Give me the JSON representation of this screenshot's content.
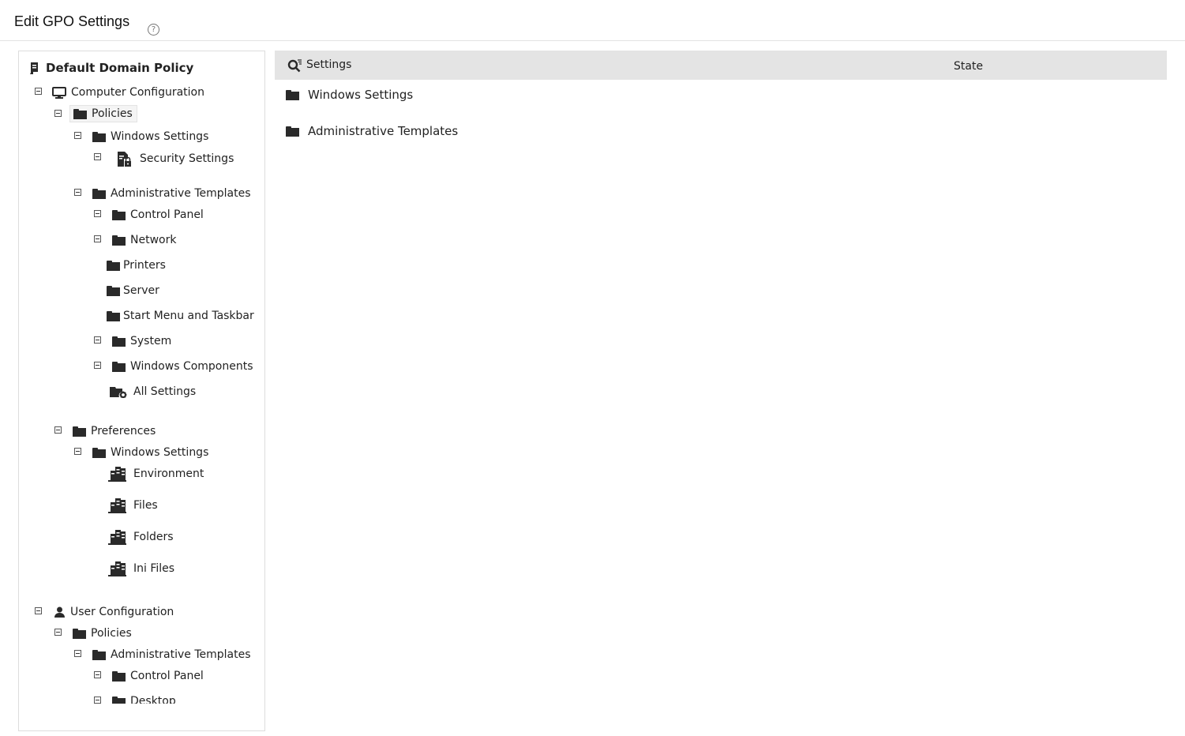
{
  "header": {
    "title": "Edit GPO Settings",
    "help_glyph": "?"
  },
  "tree": {
    "root": "Default Domain Policy",
    "computer_configuration": "Computer Configuration",
    "cc_policies": "Policies",
    "cc_windows_settings": "Windows Settings",
    "security_settings": "Security Settings",
    "cc_admin_templates": "Administrative Templates",
    "control_panel": "Control Panel",
    "network": "Network",
    "printers": "Printers",
    "server": "Server",
    "start_menu": "Start Menu and Taskbar",
    "system": "System",
    "windows_components": "Windows Components",
    "all_settings": "All Settings",
    "preferences": "Preferences",
    "pref_windows_settings": "Windows Settings",
    "environment": "Environment",
    "files": "Files",
    "folders": "Folders",
    "ini_files": "Ini Files",
    "user_configuration": "User Configuration",
    "uc_policies": "Policies",
    "uc_admin_templates": "Administrative Templates",
    "uc_control_panel": "Control Panel",
    "uc_desktop": "Desktop"
  },
  "table": {
    "col_settings": "Settings",
    "col_state": "State",
    "rows": [
      "Windows Settings",
      "Administrative Templates"
    ]
  }
}
